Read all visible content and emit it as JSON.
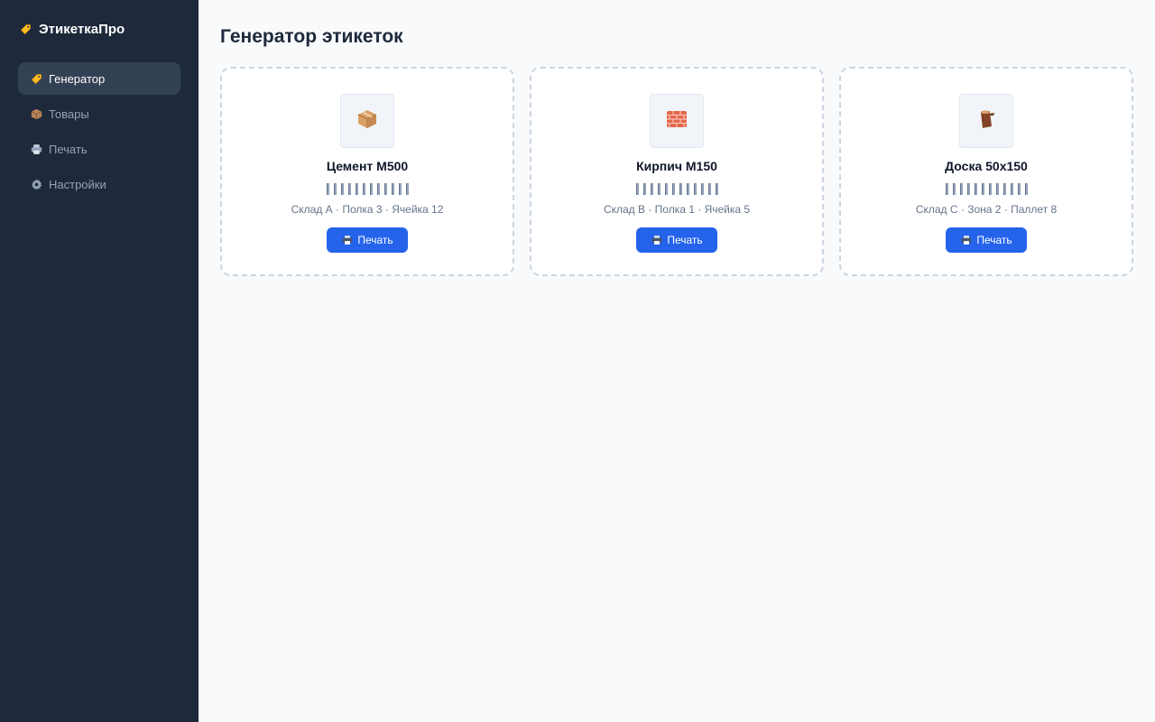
{
  "app": {
    "name": "ЭтикеткаПро",
    "logo_icon": "tag-icon"
  },
  "sidebar": {
    "items": [
      {
        "label": "Генератор",
        "icon": "tag-icon",
        "active": true
      },
      {
        "label": "Товары",
        "icon": "box-icon",
        "active": false
      },
      {
        "label": "Печать",
        "icon": "printer-icon",
        "active": false
      },
      {
        "label": "Настройки",
        "icon": "gear-icon",
        "active": false
      }
    ]
  },
  "main": {
    "title": "Генератор этикеток",
    "cards": [
      {
        "name": "Цемент М500",
        "location": "Склад А · Полка 3 · Ячейка 12",
        "button": "Печать",
        "icon": "package-icon"
      },
      {
        "name": "Кирпич М150",
        "location": "Склад B · Полка 1 · Ячейка 5",
        "button": "Печать",
        "icon": "brick-icon"
      },
      {
        "name": "Доска 50х150",
        "location": "Склад C · Зона 2 · Паллет 8",
        "button": "Печать",
        "icon": "wood-icon"
      }
    ]
  },
  "colors": {
    "sidebar_bg": "#1e293b",
    "active_item_bg": "#334155",
    "accent": "#2563eb",
    "page_bg": "#f8fafc"
  }
}
